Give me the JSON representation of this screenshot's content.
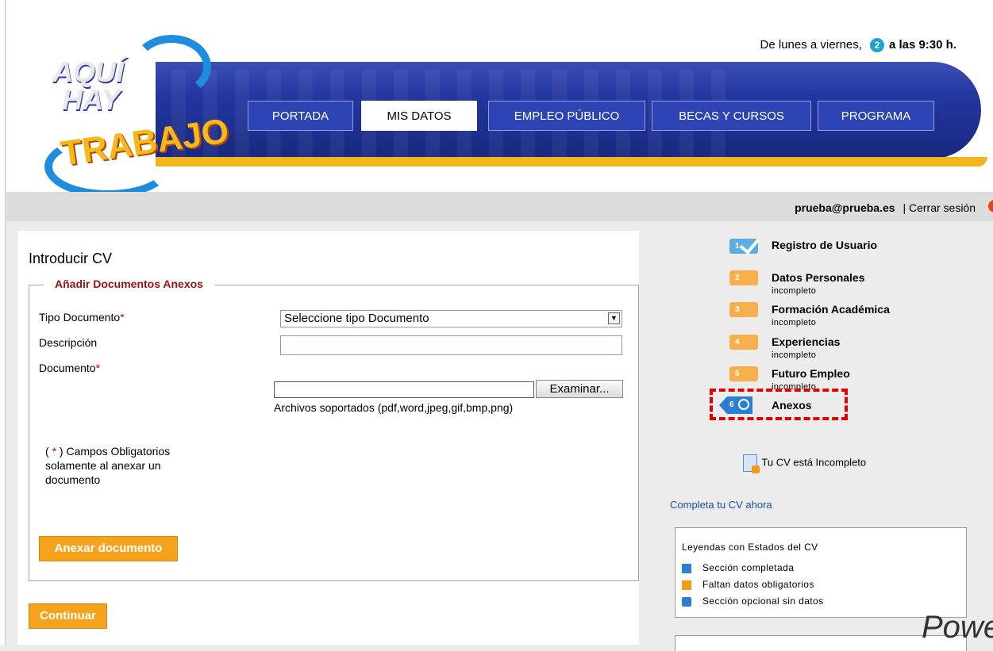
{
  "header": {
    "schedule_prefix": "De lunes a viernes,",
    "schedule_badge": "2",
    "schedule_suffix": "a las 9:30 h.",
    "logo": {
      "line1": "AQUÍ",
      "line2": "HAY",
      "line3": "TRABAJO"
    }
  },
  "nav": [
    {
      "label": "PORTADA",
      "active": false
    },
    {
      "label": "MIS DATOS",
      "active": true
    },
    {
      "label": "EMPLEO PÚBLICO",
      "active": false
    },
    {
      "label": "BECAS Y CURSOS",
      "active": false
    },
    {
      "label": "PROGRAMA",
      "active": false
    }
  ],
  "userbar": {
    "email": "prueba@prueba.es",
    "separator": "|",
    "logout": "Cerrar sesión"
  },
  "form": {
    "page_title": "Introducir CV",
    "section_title": "Añadir Documentos Anexos",
    "tipo_label": "Tipo Documento",
    "required_mark": "*",
    "tipo_selected": "Seleccione tipo Documento",
    "descripcion_label": "Descripción",
    "descripcion_value": "",
    "documento_label": "Documento",
    "browse_label": "Examinar...",
    "supported": "Archivos soportados (pdf,word,jpeg,gif,bmp,png)",
    "notes_open": "( ",
    "notes_star": "*",
    "notes_close": " ) Campos Obligatorios solamente al anexar un documento",
    "attach_button": "Anexar documento",
    "continue_button": "Continuar"
  },
  "steps": [
    {
      "num": "1",
      "title": "Registro de Usuario",
      "status": "",
      "state": "complete"
    },
    {
      "num": "2",
      "title": "Datos Personales",
      "status": "incompleto",
      "state": "missing"
    },
    {
      "num": "3",
      "title": "Formación Académica",
      "status": "incompleto",
      "state": "missing"
    },
    {
      "num": "4",
      "title": "Experiencias",
      "status": "incompleto",
      "state": "missing"
    },
    {
      "num": "5",
      "title": "Futuro Empleo",
      "status": "incompleto",
      "state": "missing"
    },
    {
      "num": "6",
      "title": "Anexos",
      "status": "",
      "state": "optional"
    }
  ],
  "sidebar": {
    "cv_status": "Tu CV está Incompleto",
    "complete_link": "Completa tu CV ahora",
    "legend_title": "Leyendas con Estados del CV",
    "legend": [
      {
        "label": "Sección completada",
        "color": "#2a7fd0",
        "icon": "check-icon"
      },
      {
        "label": "Faltan datos obligatorios",
        "color": "#f39c12",
        "icon": "orange-square-icon"
      },
      {
        "label": "Sección opcional sin datos",
        "color": "#2a7fd0",
        "icon": "optional-icon"
      }
    ],
    "powered": "Powe"
  },
  "colors": {
    "accent_orange": "#f5a21d",
    "nav_blue": "#2e44b4",
    "legend_red": "#9b1010"
  }
}
